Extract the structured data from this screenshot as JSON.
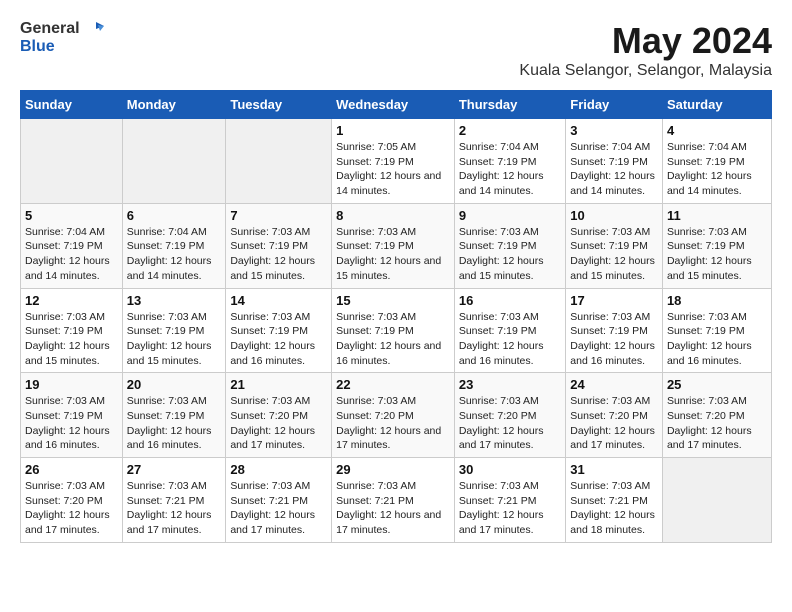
{
  "app": {
    "logo_general": "General",
    "logo_blue": "Blue"
  },
  "title": "May 2024",
  "subtitle": "Kuala Selangor, Selangor, Malaysia",
  "headers": [
    "Sunday",
    "Monday",
    "Tuesday",
    "Wednesday",
    "Thursday",
    "Friday",
    "Saturday"
  ],
  "weeks": [
    [
      {
        "num": "",
        "info": ""
      },
      {
        "num": "",
        "info": ""
      },
      {
        "num": "",
        "info": ""
      },
      {
        "num": "1",
        "info": "Sunrise: 7:05 AM\nSunset: 7:19 PM\nDaylight: 12 hours\nand 14 minutes."
      },
      {
        "num": "2",
        "info": "Sunrise: 7:04 AM\nSunset: 7:19 PM\nDaylight: 12 hours\nand 14 minutes."
      },
      {
        "num": "3",
        "info": "Sunrise: 7:04 AM\nSunset: 7:19 PM\nDaylight: 12 hours\nand 14 minutes."
      },
      {
        "num": "4",
        "info": "Sunrise: 7:04 AM\nSunset: 7:19 PM\nDaylight: 12 hours\nand 14 minutes."
      }
    ],
    [
      {
        "num": "5",
        "info": "Sunrise: 7:04 AM\nSunset: 7:19 PM\nDaylight: 12 hours\nand 14 minutes."
      },
      {
        "num": "6",
        "info": "Sunrise: 7:04 AM\nSunset: 7:19 PM\nDaylight: 12 hours\nand 14 minutes."
      },
      {
        "num": "7",
        "info": "Sunrise: 7:03 AM\nSunset: 7:19 PM\nDaylight: 12 hours\nand 15 minutes."
      },
      {
        "num": "8",
        "info": "Sunrise: 7:03 AM\nSunset: 7:19 PM\nDaylight: 12 hours\nand 15 minutes."
      },
      {
        "num": "9",
        "info": "Sunrise: 7:03 AM\nSunset: 7:19 PM\nDaylight: 12 hours\nand 15 minutes."
      },
      {
        "num": "10",
        "info": "Sunrise: 7:03 AM\nSunset: 7:19 PM\nDaylight: 12 hours\nand 15 minutes."
      },
      {
        "num": "11",
        "info": "Sunrise: 7:03 AM\nSunset: 7:19 PM\nDaylight: 12 hours\nand 15 minutes."
      }
    ],
    [
      {
        "num": "12",
        "info": "Sunrise: 7:03 AM\nSunset: 7:19 PM\nDaylight: 12 hours\nand 15 minutes."
      },
      {
        "num": "13",
        "info": "Sunrise: 7:03 AM\nSunset: 7:19 PM\nDaylight: 12 hours\nand 15 minutes."
      },
      {
        "num": "14",
        "info": "Sunrise: 7:03 AM\nSunset: 7:19 PM\nDaylight: 12 hours\nand 16 minutes."
      },
      {
        "num": "15",
        "info": "Sunrise: 7:03 AM\nSunset: 7:19 PM\nDaylight: 12 hours\nand 16 minutes."
      },
      {
        "num": "16",
        "info": "Sunrise: 7:03 AM\nSunset: 7:19 PM\nDaylight: 12 hours\nand 16 minutes."
      },
      {
        "num": "17",
        "info": "Sunrise: 7:03 AM\nSunset: 7:19 PM\nDaylight: 12 hours\nand 16 minutes."
      },
      {
        "num": "18",
        "info": "Sunrise: 7:03 AM\nSunset: 7:19 PM\nDaylight: 12 hours\nand 16 minutes."
      }
    ],
    [
      {
        "num": "19",
        "info": "Sunrise: 7:03 AM\nSunset: 7:19 PM\nDaylight: 12 hours\nand 16 minutes."
      },
      {
        "num": "20",
        "info": "Sunrise: 7:03 AM\nSunset: 7:19 PM\nDaylight: 12 hours\nand 16 minutes."
      },
      {
        "num": "21",
        "info": "Sunrise: 7:03 AM\nSunset: 7:20 PM\nDaylight: 12 hours\nand 17 minutes."
      },
      {
        "num": "22",
        "info": "Sunrise: 7:03 AM\nSunset: 7:20 PM\nDaylight: 12 hours\nand 17 minutes."
      },
      {
        "num": "23",
        "info": "Sunrise: 7:03 AM\nSunset: 7:20 PM\nDaylight: 12 hours\nand 17 minutes."
      },
      {
        "num": "24",
        "info": "Sunrise: 7:03 AM\nSunset: 7:20 PM\nDaylight: 12 hours\nand 17 minutes."
      },
      {
        "num": "25",
        "info": "Sunrise: 7:03 AM\nSunset: 7:20 PM\nDaylight: 12 hours\nand 17 minutes."
      }
    ],
    [
      {
        "num": "26",
        "info": "Sunrise: 7:03 AM\nSunset: 7:20 PM\nDaylight: 12 hours\nand 17 minutes."
      },
      {
        "num": "27",
        "info": "Sunrise: 7:03 AM\nSunset: 7:21 PM\nDaylight: 12 hours\nand 17 minutes."
      },
      {
        "num": "28",
        "info": "Sunrise: 7:03 AM\nSunset: 7:21 PM\nDaylight: 12 hours\nand 17 minutes."
      },
      {
        "num": "29",
        "info": "Sunrise: 7:03 AM\nSunset: 7:21 PM\nDaylight: 12 hours\nand 17 minutes."
      },
      {
        "num": "30",
        "info": "Sunrise: 7:03 AM\nSunset: 7:21 PM\nDaylight: 12 hours\nand 17 minutes."
      },
      {
        "num": "31",
        "info": "Sunrise: 7:03 AM\nSunset: 7:21 PM\nDaylight: 12 hours\nand 18 minutes."
      },
      {
        "num": "",
        "info": ""
      }
    ]
  ]
}
